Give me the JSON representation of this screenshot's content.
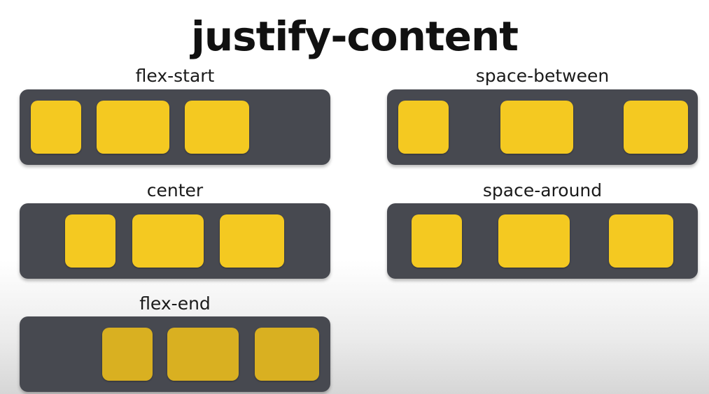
{
  "title": "justify-content",
  "colors": {
    "container": "#474950",
    "item": "#f4c921"
  },
  "examples": [
    {
      "label": "flex-start"
    },
    {
      "label": "space-between"
    },
    {
      "label": "center"
    },
    {
      "label": "space-around"
    },
    {
      "label": "flex-end"
    }
  ]
}
